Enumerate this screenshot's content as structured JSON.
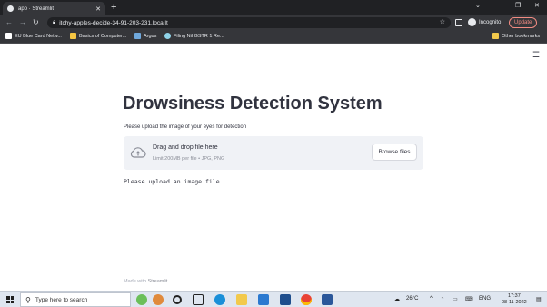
{
  "browser": {
    "tab_title": "app · Streamlit",
    "url": "itchy-apples-decide-34-91-203-231.loca.lt",
    "profile_label": "Incognito",
    "update_label": "Update",
    "bookmarks": [
      {
        "label": "EU Blue Card Netw..."
      },
      {
        "label": "Basics of Computer..."
      },
      {
        "label": "Argus"
      },
      {
        "label": "Filing Nil GSTR 1 Re..."
      }
    ],
    "other_bookmarks": "Other bookmarks"
  },
  "app": {
    "title": "Drowsiness Detection System",
    "uploader_label": "Please upload the image of your eyes for detection",
    "dropzone_title": "Drag and drop file here",
    "dropzone_limit": "Limit 200MB per file • JPG, PNG",
    "browse_label": "Browse files",
    "message": "Please upload an image file",
    "footer_prefix": "Made with ",
    "footer_brand": "Streamlit"
  },
  "taskbar": {
    "search_placeholder": "Type here to search",
    "temperature": "26°C",
    "language": "ENG",
    "time": "17:37",
    "date": "08-11-2022"
  }
}
